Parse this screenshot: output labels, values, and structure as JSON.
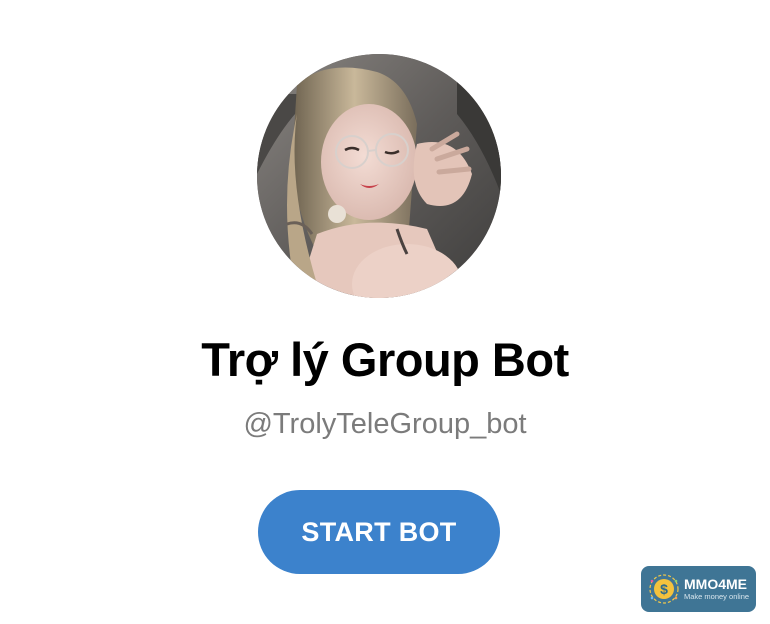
{
  "profile": {
    "display_name": "Trợ lý Group Bot",
    "username": "@TrolyTeleGroup_bot"
  },
  "actions": {
    "start_label": "START BOT"
  },
  "watermark": {
    "brand": "MMO4ME",
    "tagline": "Make money online"
  },
  "colors": {
    "button": "#3c82cc",
    "username_text": "#7b7b7b",
    "watermark_bg": "#3f7595"
  }
}
